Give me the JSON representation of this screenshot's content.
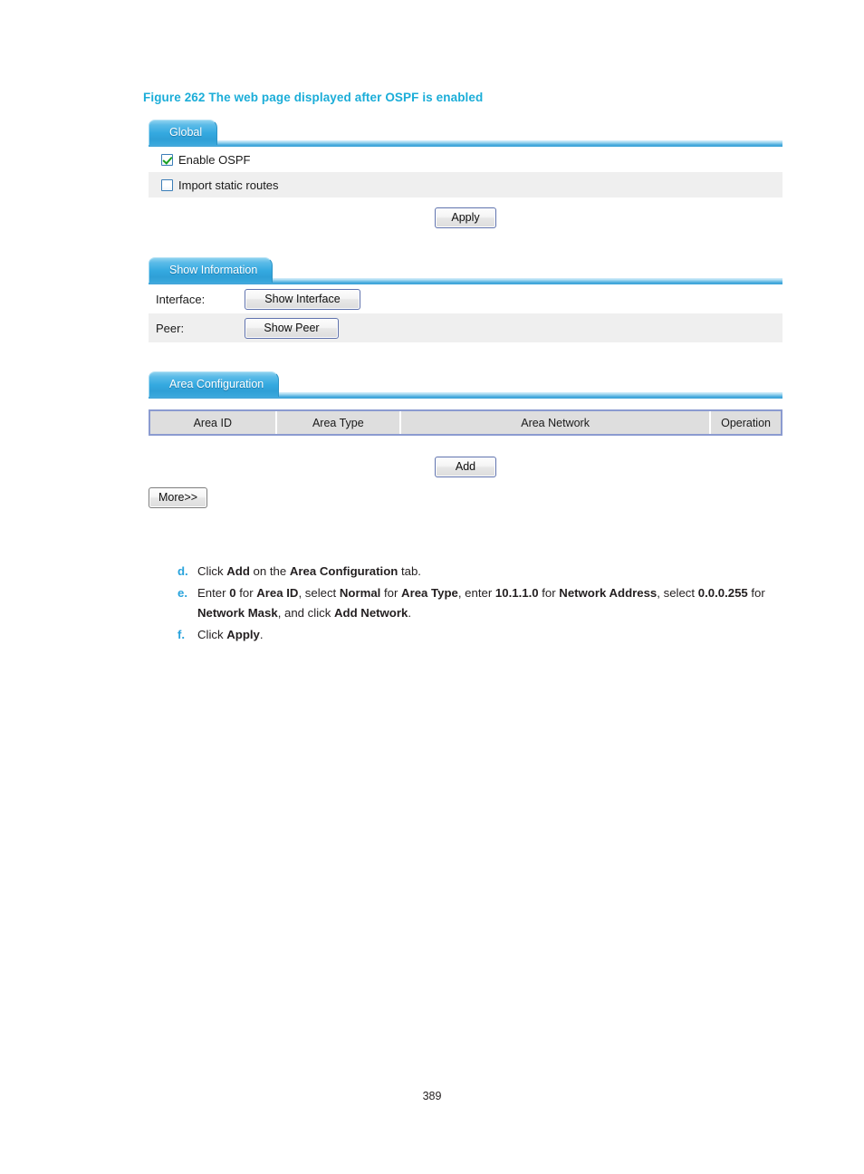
{
  "figure": {
    "caption": "Figure 262 The web page displayed after OSPF is enabled"
  },
  "global_panel": {
    "tab_label": "Global",
    "enable_ospf_label": "Enable OSPF",
    "enable_ospf_checked": true,
    "import_static_routes_label": "Import static routes",
    "import_static_routes_checked": false,
    "apply_label": "Apply"
  },
  "show_information_panel": {
    "tab_label": "Show Information",
    "interface_label": "Interface:",
    "show_interface_button": "Show Interface",
    "peer_label": "Peer:",
    "show_peer_button": "Show Peer"
  },
  "area_configuration_panel": {
    "tab_label": "Area Configuration",
    "columns": [
      "Area ID",
      "Area Type",
      "Area Network",
      "Operation"
    ],
    "rows": [],
    "add_label": "Add",
    "more_label": "More>>"
  },
  "steps": [
    {
      "marker": "d.",
      "parts": [
        {
          "t": "Click ",
          "b": false
        },
        {
          "t": "Add",
          "b": true
        },
        {
          "t": " on the ",
          "b": false
        },
        {
          "t": "Area Configuration",
          "b": true
        },
        {
          "t": " tab.",
          "b": false
        }
      ]
    },
    {
      "marker": "e.",
      "parts": [
        {
          "t": "Enter ",
          "b": false
        },
        {
          "t": "0",
          "b": true
        },
        {
          "t": " for ",
          "b": false
        },
        {
          "t": "Area ID",
          "b": true
        },
        {
          "t": ", select ",
          "b": false
        },
        {
          "t": "Normal",
          "b": true
        },
        {
          "t": " for ",
          "b": false
        },
        {
          "t": "Area Type",
          "b": true
        },
        {
          "t": ", enter ",
          "b": false
        },
        {
          "t": "10.1.1.0",
          "b": true
        },
        {
          "t": " for ",
          "b": false
        },
        {
          "t": "Network Address",
          "b": true
        },
        {
          "t": ", select ",
          "b": false
        },
        {
          "t": "0.0.0.255",
          "b": true
        },
        {
          "t": " for ",
          "b": false
        },
        {
          "t": "Network Mask",
          "b": true
        },
        {
          "t": ", and click ",
          "b": false
        },
        {
          "t": "Add Network",
          "b": true
        },
        {
          "t": ".",
          "b": false
        }
      ]
    },
    {
      "marker": "f.",
      "parts": [
        {
          "t": "Click ",
          "b": false
        },
        {
          "t": "Apply",
          "b": true
        },
        {
          "t": ".",
          "b": false
        }
      ]
    }
  ],
  "footer": {
    "page_number": "389"
  },
  "colors": {
    "caption_blue": "#1badd8",
    "tab_blue": "#34a9e0",
    "marker_blue": "#29a3dc",
    "alt_row_gray": "#efefef",
    "table_header_gray": "#dedede",
    "table_border_blue": "#8b9bd0",
    "button_border_blue": "#5f72ad",
    "check_green": "#19a020"
  }
}
